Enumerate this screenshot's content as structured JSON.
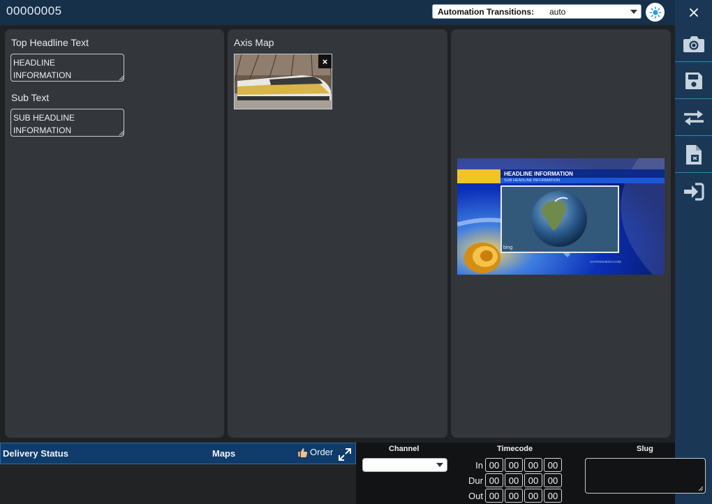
{
  "header": {
    "title": "00000005",
    "automation_label": "Automation Transitions:",
    "automation_value": "auto"
  },
  "sidebar": {
    "items": [
      {
        "icon": "camera-icon"
      },
      {
        "icon": "save-icon"
      },
      {
        "icon": "swap-icon"
      },
      {
        "icon": "file-export-icon"
      },
      {
        "icon": "sign-in-icon"
      }
    ]
  },
  "panel_text": {
    "top_label": "Top Headline Text",
    "top_value": "HEADLINE\nINFORMATION",
    "sub_label": "Sub Text",
    "sub_value": "SUB HEADLINE\nINFORMATION"
  },
  "panel_map": {
    "label": "Axis Map",
    "remove_glyph": "×"
  },
  "preview": {
    "headline": "HEADLINE INFORMATION",
    "subheadline": "SUB HEADLINE INFORMATION",
    "map_brand": "bing",
    "url_text": "CHYRONHEGO.COM"
  },
  "bottom": {
    "delivery_status": "Delivery Status",
    "maps": "Maps",
    "order": "Order",
    "channel": "Channel",
    "timecode": "Timecode",
    "slug": "Slug",
    "timecode_rows": [
      {
        "label": "In",
        "values": [
          "00",
          "00",
          "00",
          "00"
        ]
      },
      {
        "label": "Dur",
        "values": [
          "00",
          "00",
          "00",
          "00"
        ]
      },
      {
        "label": "Out",
        "values": [
          "00",
          "00",
          "00",
          "00"
        ]
      }
    ]
  }
}
